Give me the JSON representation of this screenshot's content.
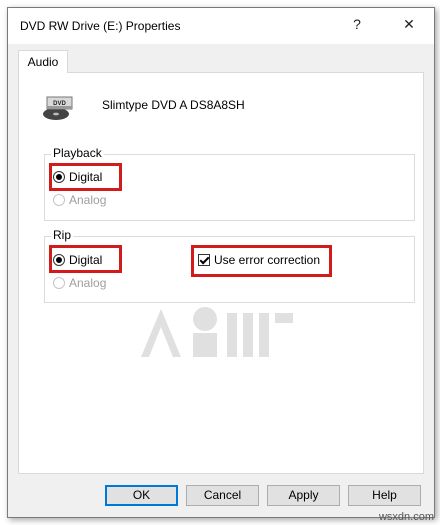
{
  "window": {
    "title": "DVD RW Drive (E:) Properties",
    "help_glyph": "?",
    "close_glyph": "✕"
  },
  "tabs": [
    {
      "label": "Audio",
      "selected": true
    }
  ],
  "device": {
    "name": "Slimtype DVD A  DS8A8SH",
    "icon": "dvd-drive-icon",
    "icon_text": "DVD"
  },
  "playback": {
    "legend": "Playback",
    "options": [
      {
        "label": "Digital",
        "checked": true,
        "enabled": true
      },
      {
        "label": "Analog",
        "checked": false,
        "enabled": false
      }
    ]
  },
  "rip": {
    "legend": "Rip",
    "options": [
      {
        "label": "Digital",
        "checked": true,
        "enabled": true
      },
      {
        "label": "Analog",
        "checked": false,
        "enabled": false
      }
    ],
    "error_correction": {
      "label": "Use error correction",
      "checked": true
    }
  },
  "buttons": {
    "ok": "OK",
    "cancel": "Cancel",
    "apply": "Apply",
    "help": "Help"
  },
  "colors": {
    "highlight": "#d21b1b",
    "default_button_border": "#0078d7"
  },
  "footer": {
    "brand": "wsxdn.com"
  }
}
